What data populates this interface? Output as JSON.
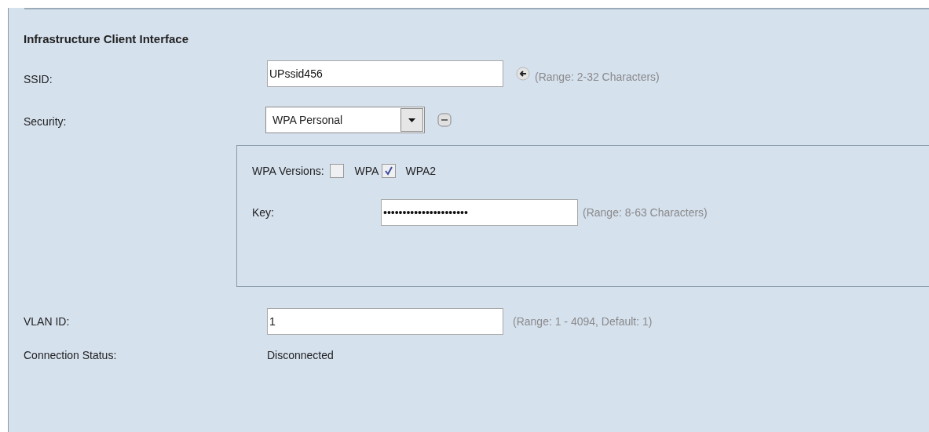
{
  "section": {
    "title": "Infrastructure Client Interface"
  },
  "ssid": {
    "label": "SSID:",
    "value": "UPssid456",
    "hint": "(Range: 2-32 Characters)"
  },
  "security": {
    "label": "Security:",
    "value": "WPA Personal",
    "expanded": true
  },
  "wpa_versions": {
    "label": "WPA Versions:",
    "options": [
      {
        "label": "WPA",
        "checked": false
      },
      {
        "label": "WPA2",
        "checked": true
      }
    ]
  },
  "key": {
    "label": "Key:",
    "value": "••••••••••••••••••••••",
    "hint": "(Range: 8-63 Characters)"
  },
  "vlan": {
    "label": "VLAN ID:",
    "value": "1",
    "hint": "(Range: 1 - 4094, Default: 1)"
  },
  "connection_status": {
    "label": "Connection Status:",
    "value": "Disconnected"
  }
}
